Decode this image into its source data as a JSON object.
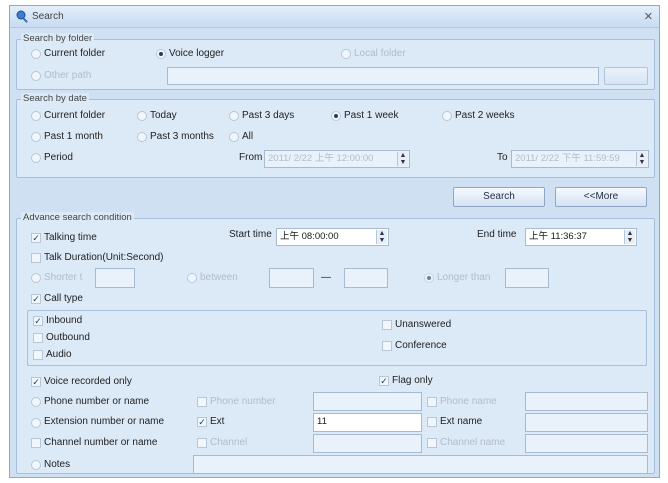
{
  "title": "Search",
  "folder": {
    "legend": "Search by folder",
    "current_folder": "Current folder",
    "voice_logger": "Voice logger",
    "local_folder": "Local folder",
    "other_path": "Other path"
  },
  "date": {
    "legend": "Search by date",
    "current_folder": "Current folder",
    "today": "Today",
    "past3days": "Past 3 days",
    "past1week": "Past 1 week",
    "past2weeks": "Past 2 weeks",
    "past1month": "Past 1 month",
    "past3months": "Past 3 months",
    "all": "All",
    "period": "Period",
    "from_label": "From",
    "from_value": "2011/ 2/22 上午 12:00:00",
    "to_label": "To",
    "to_value": "2011/ 2/22 下午 11:59:59"
  },
  "buttons": {
    "search": "Search",
    "more": "<<More"
  },
  "adv": {
    "legend": "Advance search condition",
    "talking_time": "Talking time",
    "start_time_label": "Start time",
    "start_time_value": "上午 08:00:00",
    "end_time_label": "End time",
    "end_time_value": "上午 11:36:37",
    "talk_duration": "Talk Duration(Unit:Second)",
    "shorter": "Shorter t",
    "between": "between",
    "dash": "—",
    "longer": "Longer than",
    "call_type": "Call type",
    "inbound": "Inbound",
    "outbound": "Outbound",
    "audio": "Audio",
    "unanswered": "Unanswered",
    "conference": "Conference",
    "voice_recorded_only": "Voice recorded only",
    "flag_only": "Flag only",
    "phone_or_name": "Phone number or name",
    "phone_number": "Phone number",
    "phone_name": "Phone name",
    "ext_or_name": "Extension number or name",
    "ext": "Ext",
    "ext_value": "11",
    "ext_name": "Ext name",
    "channel_or_name": "Channel number or name",
    "channel": "Channel",
    "channel_name": "Channel name",
    "notes": "Notes"
  }
}
